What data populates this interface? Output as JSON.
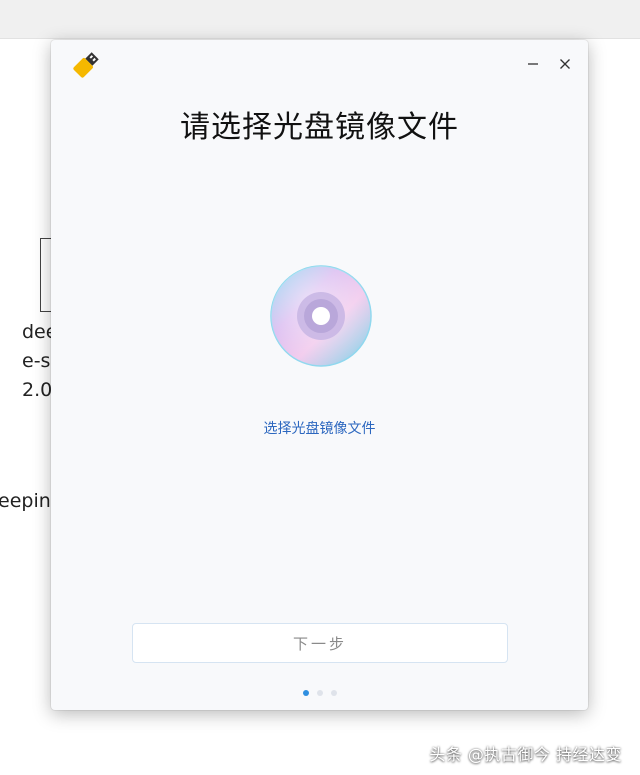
{
  "background": {
    "file_name": "dee\ne-s\n2.0",
    "folder_label": "eepin"
  },
  "dialog": {
    "title": "请选择光盘镜像文件",
    "select_link": "选择光盘镜像文件",
    "next_button": "下一步",
    "steps": {
      "total": 3,
      "current": 1
    }
  },
  "watermark": "头条 @执古御今 持经达变",
  "colors": {
    "accent": "#2f8fe0",
    "link": "#2c67bf",
    "app_icon_yellow": "#f5b800",
    "app_icon_dark": "#333333"
  },
  "icons": {
    "app": "usb-drive-icon",
    "minimize": "minimize-icon",
    "close": "close-icon",
    "disc": "optical-disc-icon"
  }
}
